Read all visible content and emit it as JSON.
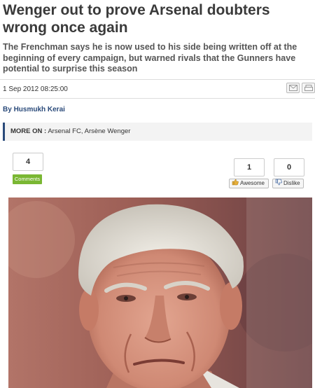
{
  "article": {
    "headline": "Wenger out to prove Arsenal doubters wrong once again",
    "standfirst": "The Frenchman says he is now used to his side being written off at the beginning of every campaign, but warned rivals that the Gunners have potential to surprise this season",
    "date": "1 Sep 2012 08:25:00",
    "byline_prefix": "By ",
    "author": "Husmukh Kerai",
    "more_on_label": "MORE ON :",
    "more_on_links": [
      "Arsenal FC",
      "Arsène Wenger"
    ]
  },
  "share": {
    "icons": [
      "email-icon",
      "print-icon"
    ]
  },
  "comments": {
    "count": "4",
    "label": "Comments"
  },
  "votes": {
    "awesome_count": "1",
    "awesome_label": "Awesome",
    "dislike_count": "0",
    "dislike_label": "Dislike"
  },
  "colors": {
    "accent": "#2a4a7a",
    "comments_green": "#7ab733"
  }
}
